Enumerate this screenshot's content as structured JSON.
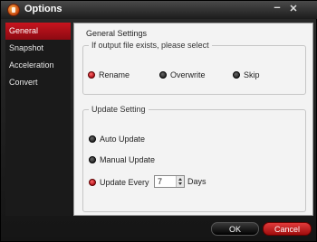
{
  "window": {
    "title": "Options"
  },
  "sidebar": {
    "items": [
      {
        "label": "General",
        "active": true
      },
      {
        "label": "Snapshot",
        "active": false
      },
      {
        "label": "Acceleration",
        "active": false
      },
      {
        "label": "Convert",
        "active": false
      }
    ]
  },
  "panel": {
    "title": "General Settings",
    "file_exists_group": {
      "legend": "If output file exists, please select",
      "options": [
        "Rename",
        "Overwrite",
        "Skip"
      ],
      "selected": "Rename"
    },
    "update_group": {
      "legend": "Update Setting",
      "options": [
        "Auto Update",
        "Manual Update",
        "Update Every"
      ],
      "selected": "Update Every",
      "interval_value": "7",
      "interval_unit": "Days"
    }
  },
  "buttons": {
    "ok": "OK",
    "cancel": "Cancel"
  },
  "colors": {
    "accent_red": "#c8141e",
    "panel_bg": "#f3f3f3",
    "window_bg": "#151515"
  }
}
